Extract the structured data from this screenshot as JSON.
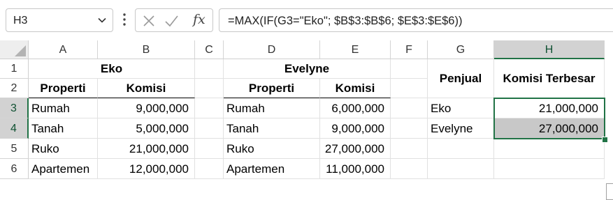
{
  "formula_bar": {
    "name_box": "H3",
    "fx_label": "fx",
    "formula": "=MAX(IF(G3=\"Eko\"; $B$3:$B$6; $E$3:$E$6))"
  },
  "columns": [
    "A",
    "B",
    "C",
    "D",
    "E",
    "F",
    "G",
    "H"
  ],
  "rows": [
    "1",
    "2",
    "3",
    "4",
    "5",
    "6"
  ],
  "sheet": {
    "eko_title": "Eko",
    "eko_headers": [
      "Properti",
      "Komisi"
    ],
    "eko_rows": [
      [
        "Rumah",
        "9,000,000"
      ],
      [
        "Tanah",
        "5,000,000"
      ],
      [
        "Ruko",
        "21,000,000"
      ],
      [
        "Apartemen",
        "12,000,000"
      ]
    ],
    "evelyne_title": "Evelyne",
    "evelyne_headers": [
      "Properti",
      "Komisi"
    ],
    "evelyne_rows": [
      [
        "Rumah",
        "6,000,000"
      ],
      [
        "Tanah",
        "9,000,000"
      ],
      [
        "Ruko",
        "27,000,000"
      ],
      [
        "Apartemen",
        "11,000,000"
      ]
    ],
    "result_headers": [
      "Penjual",
      "Komisi Terbesar"
    ],
    "result_rows": [
      [
        "Eko",
        "21,000,000"
      ],
      [
        "Evelyne",
        "27,000,000"
      ]
    ]
  },
  "selection": {
    "active_cell": "H3",
    "range": "H3:H4"
  },
  "colors": {
    "accent": "#217346",
    "highlight": "#c8c8c8"
  },
  "icons": [
    "chevron-down-icon",
    "more-options-icon",
    "cancel-icon",
    "enter-icon",
    "function-icon"
  ]
}
